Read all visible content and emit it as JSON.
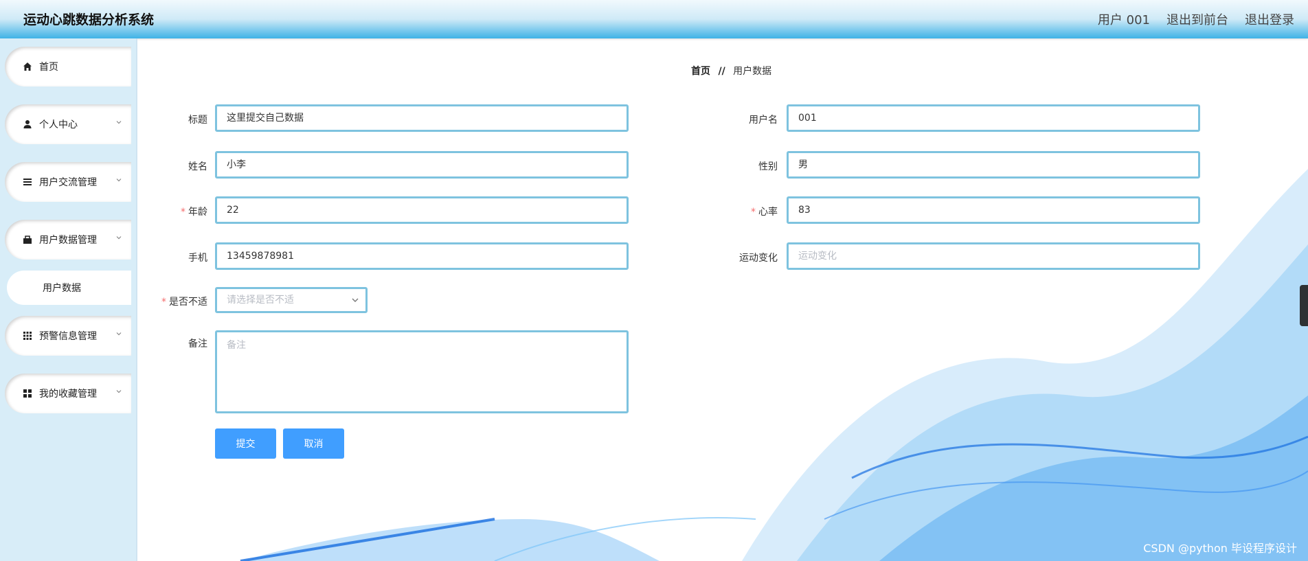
{
  "header": {
    "title": "运动心跳数据分析系统",
    "user": "用户 001",
    "to_front": "退出到前台",
    "logout": "退出登录"
  },
  "sidebar": {
    "items": [
      {
        "label": "首页",
        "icon": "home-icon"
      },
      {
        "label": "个人中心",
        "icon": "user-icon"
      },
      {
        "label": "用户交流管理",
        "icon": "list-icon"
      },
      {
        "label": "用户数据管理",
        "icon": "briefcase-icon"
      },
      {
        "label": "预警信息管理",
        "icon": "grid-icon"
      },
      {
        "label": "我的收藏管理",
        "icon": "apps-icon"
      }
    ],
    "sub_item": "用户数据"
  },
  "breadcrumb": {
    "home": "首页",
    "sep": "//",
    "current": "用户数据"
  },
  "form": {
    "title_label": "标题",
    "title_value": "这里提交自己数据",
    "username_label": "用户名",
    "username_value": "001",
    "name_label": "姓名",
    "name_value": "小李",
    "gender_label": "性别",
    "gender_value": "男",
    "age_label": "年龄",
    "age_value": "22",
    "heart_label": "心率",
    "heart_value": "83",
    "phone_label": "手机",
    "phone_value": "13459878981",
    "change_label": "运动变化",
    "change_placeholder": "运动变化",
    "discomfort_label": "是否不适",
    "discomfort_placeholder": "请选择是否不适",
    "note_label": "备注",
    "note_placeholder": "备注",
    "submit": "提交",
    "cancel": "取消"
  },
  "watermark": "CSDN @python 毕设程序设计",
  "colors": {
    "accent": "#409eff",
    "border": "#7ec3df",
    "required": "#f56c6c"
  }
}
